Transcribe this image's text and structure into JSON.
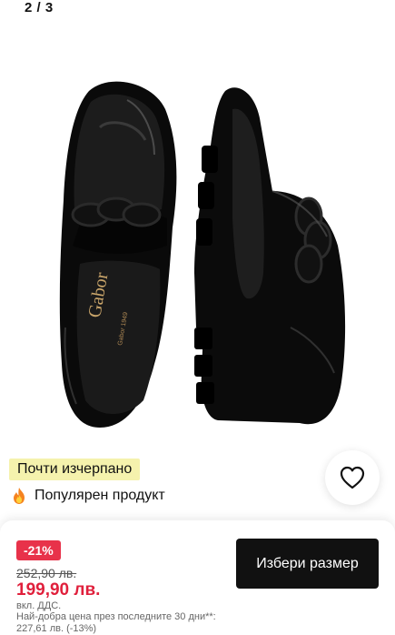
{
  "gallery": {
    "counter": "2 / 3",
    "image_alt": "Gabor black patent loafers with chain"
  },
  "badges": {
    "low_stock": "Почти изчерпано",
    "popular": "Популярен продукт"
  },
  "icons": {
    "flame": "flame-icon",
    "wishlist": "heart-outline-icon"
  },
  "price": {
    "discount": "-21%",
    "old": "252,90 лв.",
    "new": "199,90 лв.",
    "vat": "вкл. ДДС.",
    "best_30_days_label": "Най-добра цена през последните 30 дни**:",
    "best_30_days_value": "227,61 лв. (-13%)"
  },
  "actions": {
    "select_size": "Избери размер"
  },
  "colors": {
    "discount_red": "#e8324a",
    "price_red": "#e0203c",
    "low_stock_bg": "#f5f2ad",
    "button_black": "#111111"
  }
}
